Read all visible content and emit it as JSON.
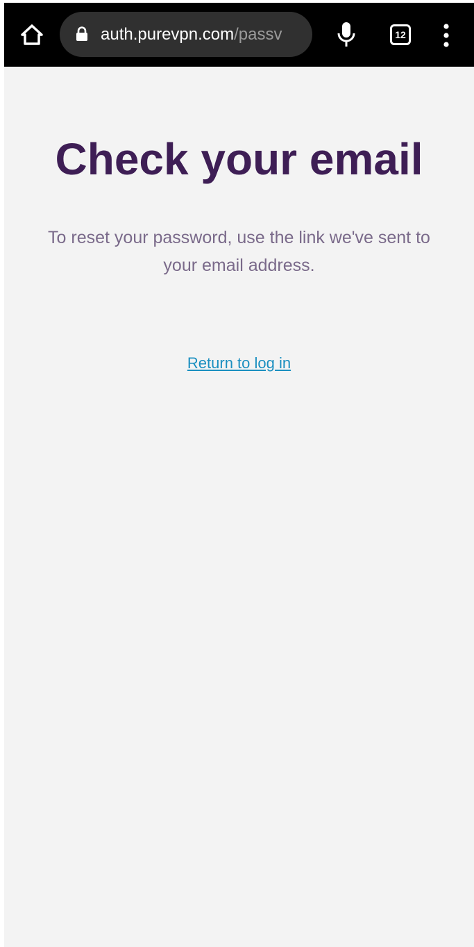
{
  "browser": {
    "url_host": "auth.purevpn.com",
    "url_path": "/passv",
    "tab_count": "12"
  },
  "page": {
    "heading": "Check your email",
    "message": "To reset your password, use the link we've sent to your email address.",
    "return_link": "Return to log in"
  },
  "colors": {
    "heading": "#3e1e55",
    "message": "#7a6a8a",
    "link": "#1a8fc0",
    "page_background": "#f3f3f3",
    "toolbar_background": "#000000"
  },
  "icons": {
    "home": "home-icon",
    "lock": "lock-icon",
    "mic": "microphone-icon",
    "tabs": "tab-switcher-icon",
    "menu": "more-vertical-icon"
  }
}
